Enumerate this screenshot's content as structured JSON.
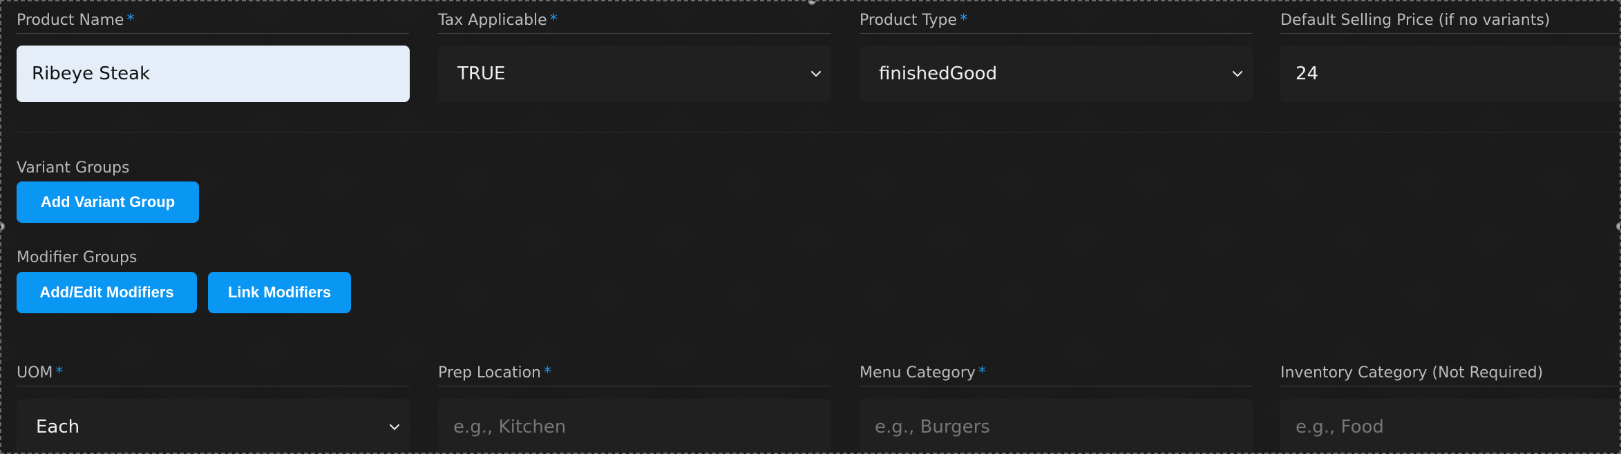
{
  "row1": {
    "fields": [
      {
        "label": "Product Name",
        "required": "*",
        "value": "Ribeye Steak"
      },
      {
        "label": "Tax Applicable",
        "required": "*",
        "value": "TRUE"
      },
      {
        "label": "Product Type",
        "required": "*",
        "value": "finishedGood"
      },
      {
        "label": "Default Selling Price (if no variants)",
        "value": "24"
      }
    ]
  },
  "variants": {
    "label": "Variant Groups",
    "add_button": "Add Variant Group"
  },
  "modifiers": {
    "label": "Modifier Groups",
    "edit_button": "Add/Edit Modifiers",
    "link_button": "Link Modifiers"
  },
  "row2": {
    "fields": [
      {
        "label": "UOM",
        "required": "*",
        "value": "Each"
      },
      {
        "label": "Prep Location",
        "required": "*",
        "placeholder": "e.g., Kitchen"
      },
      {
        "label": "Menu Category",
        "required": "*",
        "placeholder": "e.g., Burgers"
      },
      {
        "label": "Inventory Category (Not Required)",
        "placeholder": "e.g., Food"
      }
    ]
  },
  "colors": {
    "accent": "#0a96f3",
    "required_marker": "#1f9bf5",
    "background": "#181818",
    "input_background": "#202020",
    "active_input_background": "#e4edf8"
  },
  "icons": {
    "select_arrow": "chevron-down-icon"
  }
}
